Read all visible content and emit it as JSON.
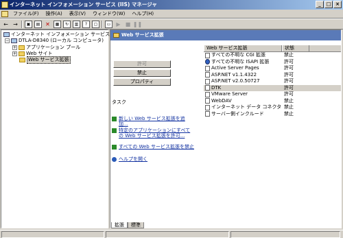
{
  "window": {
    "title": "インターネット インフォメーション サービス (IIS) マネージャ"
  },
  "menu": [
    {
      "label": "ファイル(F)"
    },
    {
      "label": "操作(A)"
    },
    {
      "label": "表示(V)"
    },
    {
      "label": "ウィンドウ(W)"
    },
    {
      "label": "ヘルプ(H)"
    }
  ],
  "tree": {
    "root": "インターネット インフォメーション サービス",
    "server": "DTLA-D8340 (ローカル コンピュータ)",
    "children": [
      {
        "label": "アプリケーション プール"
      },
      {
        "label": "Web サイト"
      },
      {
        "label": "Web サービス拡張"
      }
    ]
  },
  "panel": {
    "title": "Web サービス拡張",
    "buttons": {
      "allow": "許可",
      "deny": "禁止",
      "properties": "プロパティ"
    },
    "tasks_heading": "タスク",
    "tasks": [
      {
        "label": "新しい Web サービス拡張を追加..."
      },
      {
        "label": "特定のアプリケーションにすべての Web サービス拡張を許可..."
      },
      {
        "label": "すべての Web サービス拡張を禁止"
      },
      {
        "label": "ヘルプを開く"
      }
    ]
  },
  "list": {
    "columns": [
      "Web サービス拡張",
      "状態"
    ],
    "rows": [
      {
        "name": "すべての不明な CGI 拡張",
        "status": "禁止"
      },
      {
        "name": "すべての不明な ISAPI 拡張",
        "status": "許可"
      },
      {
        "name": "Active Server Pages",
        "status": "許可"
      },
      {
        "name": "ASP.NET v1.1.4322",
        "status": "許可"
      },
      {
        "name": "ASP.NET v2.0.50727",
        "status": "許可"
      },
      {
        "name": "DTK",
        "status": "許可"
      },
      {
        "name": "VMware Server",
        "status": "許可"
      },
      {
        "name": "WebDAV",
        "status": "禁止"
      },
      {
        "name": "インターネット データ コネクタ",
        "status": "禁止"
      },
      {
        "name": "サーバー側インクルード",
        "status": "禁止"
      }
    ]
  },
  "tabs": [
    {
      "label": "拡張"
    },
    {
      "label": "標準"
    }
  ]
}
